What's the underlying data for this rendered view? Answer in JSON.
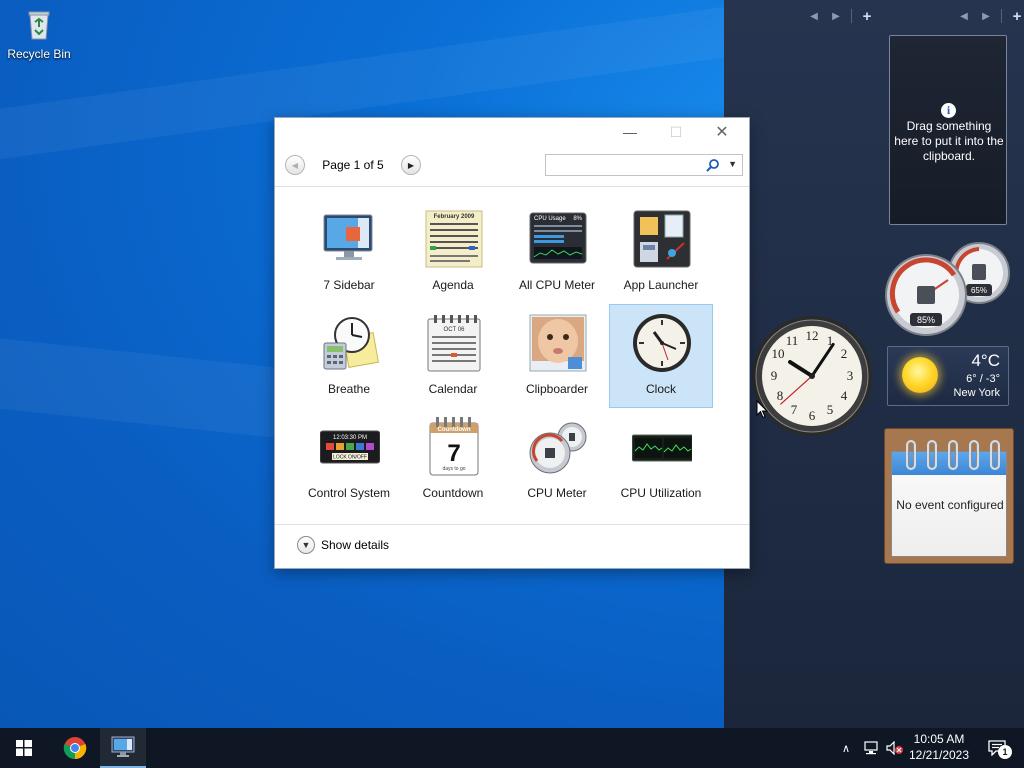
{
  "desktop": {
    "icons": [
      {
        "label": "Recycle Bin",
        "icon": "recycle-bin-icon"
      }
    ]
  },
  "sidebar": {
    "controls": [
      "previous",
      "next",
      "add"
    ],
    "clipboard": {
      "text": "Drag something here to put it into the clipboard."
    },
    "cpu_meter": {
      "cpu_percent": "85%",
      "memory_percent": "65%"
    },
    "weather": {
      "temperature": "4°C",
      "range": "6° / -3°",
      "city": "New York"
    },
    "notepad": {
      "text": "No event configured"
    },
    "clock": {
      "hour": 10,
      "minute": 5,
      "second": 38
    }
  },
  "gallery": {
    "pager": {
      "label": "Page 1 of 5",
      "prev_enabled": false,
      "next_enabled": true
    },
    "search": {
      "value": "",
      "placeholder": ""
    },
    "gadgets": [
      {
        "label": "7 Sidebar",
        "icon": "monitor-sidebar-icon",
        "selected": false
      },
      {
        "label": "Agenda",
        "icon": "agenda-calendar-icon",
        "selected": false
      },
      {
        "label": "All CPU Meter",
        "icon": "cpu-usage-icon",
        "selected": false
      },
      {
        "label": "App Launcher",
        "icon": "app-launcher-icon",
        "selected": false
      },
      {
        "label": "Breathe",
        "icon": "breathe-icon",
        "selected": false
      },
      {
        "label": "Calendar",
        "icon": "calendar-icon",
        "selected": false
      },
      {
        "label": "Clipboarder",
        "icon": "clipboarder-icon",
        "selected": false
      },
      {
        "label": "Clock",
        "icon": "clock-icon",
        "selected": true
      },
      {
        "label": "Control System",
        "icon": "control-system-icon",
        "selected": false
      },
      {
        "label": "Countdown",
        "icon": "countdown-icon",
        "selected": false
      },
      {
        "label": "CPU Meter",
        "icon": "cpu-meter-icon",
        "selected": false
      },
      {
        "label": "CPU Utilization",
        "icon": "cpu-utilization-icon",
        "selected": false
      }
    ],
    "tile_text": {
      "agenda_header": "February 2009",
      "cpu_usage_title": "CPU Usage",
      "cpu_usage_value": "8%",
      "calendar_month": "OCT 06",
      "control_time": "12:03:30 PM",
      "control_lock": "LOCK ON/OFF",
      "countdown_title": "Countdown",
      "countdown_number": "7",
      "countdown_sub": "days to go"
    },
    "details_label": "Show details"
  },
  "taskbar": {
    "time": "10:05 AM",
    "date": "12/21/2023",
    "notification_count": "1",
    "apps": [
      "start-icon",
      "chrome-icon",
      "desktop-gadgets-icon"
    ]
  },
  "colors": {
    "desktop_blue": "#0a6fd6",
    "sidebar_navy": "#222f49",
    "selection": "#cce4f7",
    "taskbar": "#0f1724"
  }
}
